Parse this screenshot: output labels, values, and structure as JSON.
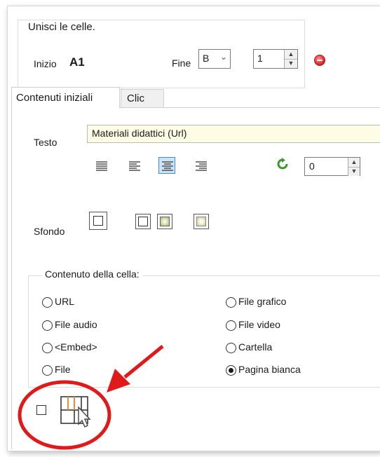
{
  "merge_group": {
    "title": "Unisci le celle.",
    "start_label": "Inizio",
    "start_value": "A1",
    "end_label": "Fine",
    "end_column": "B",
    "end_row": "1"
  },
  "tabs": [
    {
      "label": "Contenuti iniziali",
      "active": true
    },
    {
      "label": "Clic",
      "active": false
    }
  ],
  "text_field": {
    "label": "Testo",
    "value": "Materiali didattici (Url)"
  },
  "alignment_icons": [
    "align-justify-icon",
    "align-left-icon",
    "align-center-icon",
    "align-right-icon"
  ],
  "alignment_selected": "align-center-icon",
  "rotation_value": "0",
  "background": {
    "label": "Sfondo"
  },
  "content_group": {
    "title": "Contenuto della cella:",
    "options": [
      {
        "label": "URL",
        "checked": false
      },
      {
        "label": "File grafico",
        "checked": false
      },
      {
        "label": "File audio",
        "checked": false
      },
      {
        "label": "File video",
        "checked": false
      },
      {
        "label": "<Embed>",
        "checked": false
      },
      {
        "label": "Cartella",
        "checked": false
      },
      {
        "label": "File",
        "checked": false
      },
      {
        "label": "Pagina bianca",
        "checked": true
      }
    ]
  },
  "annotation_color": "#e0191b",
  "accent_orange": "#f28c28"
}
